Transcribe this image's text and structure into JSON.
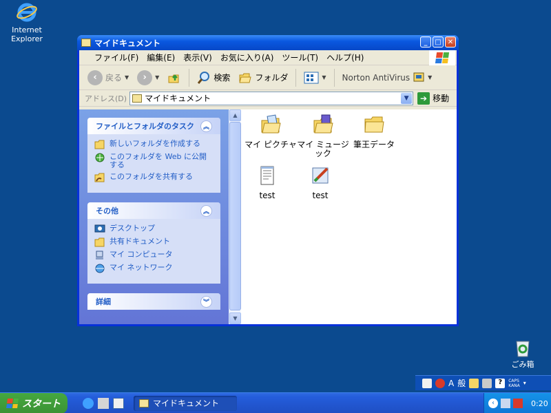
{
  "desktop": {
    "ie_label": "Internet Explorer",
    "trash_label": "ごみ箱"
  },
  "window": {
    "title": "マイドキュメント",
    "menu": [
      "ファイル(F)",
      "編集(E)",
      "表示(V)",
      "お気に入り(A)",
      "ツール(T)",
      "ヘルプ(H)"
    ],
    "toolbar": {
      "back": "戻る",
      "search": "検索",
      "folders": "フォルダ",
      "norton": "Norton AntiVirus"
    },
    "address": {
      "label": "アドレス(D)",
      "value": "マイドキュメント",
      "go": "移動"
    }
  },
  "tasks_panel": {
    "title": "ファイルとフォルダのタスク",
    "items": [
      "新しいフォルダを作成する",
      "このフォルダを Web に公開する",
      "このフォルダを共有する"
    ]
  },
  "other_panel": {
    "title": "その他",
    "items": [
      "デスクトップ",
      "共有ドキュメント",
      "マイ コンピュータ",
      "マイ ネットワーク"
    ]
  },
  "details_panel": {
    "title": "詳細"
  },
  "files": [
    {
      "name": "マイ ピクチャ",
      "icon": "pictures-folder-icon"
    },
    {
      "name": "マイ ミュージック",
      "icon": "music-folder-icon"
    },
    {
      "name": "筆王データ",
      "icon": "folder-icon"
    },
    {
      "name": "test",
      "icon": "text-document-icon"
    },
    {
      "name": "test",
      "icon": "paint-image-icon"
    }
  ],
  "langbar": {
    "mode": "A",
    "ime": "般",
    "caps": "CAPS",
    "kana": "KANA"
  },
  "taskbar": {
    "start": "スタート",
    "task_title": "マイドキュメント",
    "clock": "0:20"
  },
  "colors": {
    "desktop": "#0b4a8f",
    "title_bar": "#0a58e0",
    "task_pane": "#6375d6",
    "start_green": "#3b9234"
  }
}
